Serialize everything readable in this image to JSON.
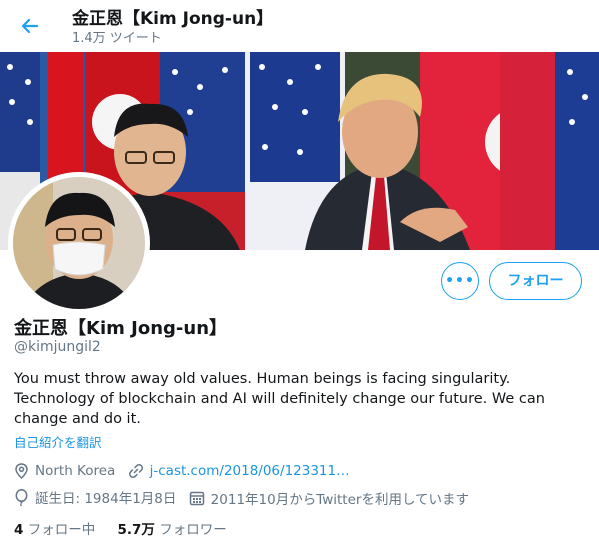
{
  "header": {
    "name": "金正恩【Kim Jong-un】",
    "tweet_count": "1.4万 ツイート"
  },
  "profile": {
    "display_name": "金正恩【Kim Jong-un】",
    "handle": "@kimjungil2",
    "bio": "You must throw away old values. Human beings is facing singularity. Technology of blockchain and AI will definitely change our future. We can change and do it.",
    "translate_label": "自己紹介を翻訳",
    "location": "North Korea",
    "link": "j-cast.com/2018/06/123311…",
    "birthday": "誕生日: 1984年1月8日",
    "joined": "2011年10月からTwitterを利用しています"
  },
  "buttons": {
    "more": "•••",
    "follow": "フォロー"
  },
  "stats": {
    "following_count": "4",
    "following_label": "フォロー中",
    "followers_count": "5.7万",
    "followers_label": "フォロワー"
  },
  "colors": {
    "accent": "#1da1f2",
    "link": "#1b95e0",
    "muted": "#657786"
  },
  "icons": {
    "back": "arrow-left-icon",
    "location": "location-pin-icon",
    "link": "link-icon",
    "birthday": "balloon-icon",
    "joined": "calendar-icon"
  }
}
